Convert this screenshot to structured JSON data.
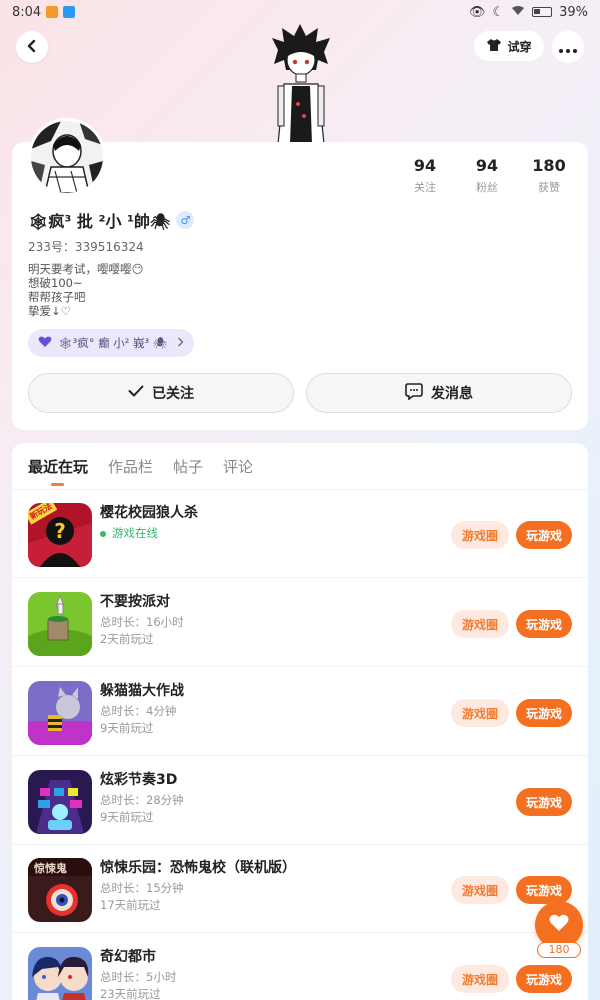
{
  "status_bar": {
    "time": "8:04",
    "battery": "39%"
  },
  "header": {
    "try_on_label": "试穿"
  },
  "profile": {
    "nickname": "🕸疯³ 批 ²小 ¹帥🕷",
    "gender": "♂",
    "uid": "233号：339516324",
    "bio_lines": [
      "明天要考试，嘤嘤嘤😶",
      "想破100~",
      "帮帮孩子吧",
      "挚爱↓♡"
    ],
    "fan_badge": "🕸³疯° 癫 小² 峩³ 🕷",
    "stats": [
      {
        "num": "94",
        "label": "关注"
      },
      {
        "num": "94",
        "label": "粉丝"
      },
      {
        "num": "180",
        "label": "获赞"
      }
    ],
    "follow_label": "已关注",
    "message_label": "发消息"
  },
  "tabs": [
    "最近在玩",
    "作品栏",
    "帖子",
    "评论"
  ],
  "games": [
    {
      "name": "樱花校园狼人杀",
      "line1": "游戏在线",
      "line2": "",
      "online": true,
      "circle": "游戏圈",
      "play": "玩游戏",
      "new_tag": "新玩法"
    },
    {
      "name": "不要按派对",
      "line1": "总时长：16小时",
      "line2": "2天前玩过",
      "circle": "游戏圈",
      "play": "玩游戏"
    },
    {
      "name": "躲猫猫大作战",
      "line1": "总时长：4分钟",
      "line2": "9天前玩过",
      "circle": "游戏圈",
      "play": "玩游戏"
    },
    {
      "name": "炫彩节奏3D",
      "line1": "总时长：28分钟",
      "line2": "9天前玩过",
      "circle": "",
      "play": "玩游戏"
    },
    {
      "name": "惊悚乐园：恐怖鬼校（联机版）",
      "line1": "总时长：15分钟",
      "line2": "17天前玩过",
      "circle": "游戏圈",
      "play": "玩游戏"
    },
    {
      "name": "奇幻都市",
      "line1": "总时长：5小时",
      "line2": "23天前玩过",
      "circle": "游戏圈",
      "play": "玩游戏"
    }
  ],
  "like_count": "180",
  "colors": {
    "accent": "#f47020",
    "accent_light": "#fde9df",
    "online_green": "#33b86a",
    "gender_blue": "#3d8ff5"
  }
}
